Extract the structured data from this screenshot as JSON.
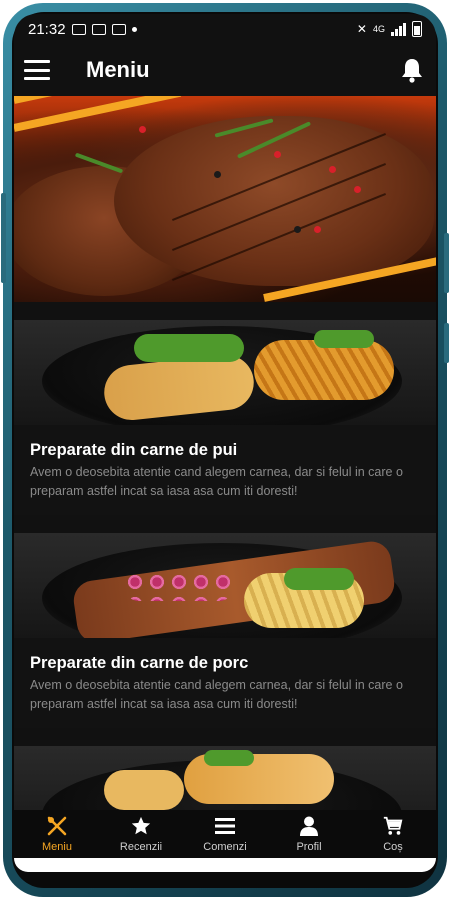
{
  "status_bar": {
    "time": "21:32"
  },
  "app_bar": {
    "title": "Meniu",
    "menu_icon": "hamburger-icon",
    "notification_icon": "bell-icon"
  },
  "hero": {
    "image": "grilled-steak-banner"
  },
  "categories": [
    {
      "title": "Preparate din carne de pui",
      "description": "Avem o deosebita atentie cand alegem carnea, dar si felul in care o preparam astfel incat sa iasa asa cum iti doresti!",
      "image": "chicken-strips-fries"
    },
    {
      "title": "Preparate din carne de porc",
      "description": "Avem o deosebita atentie cand alegem carnea, dar si felul in care o preparam astfel incat sa iasa asa cum iti doresti!",
      "image": "pork-ribs-fries"
    }
  ],
  "bottom_nav": {
    "items": [
      {
        "label": "Meniu",
        "icon": "fork-knife-icon",
        "active": true
      },
      {
        "label": "Recenzii",
        "icon": "star-icon",
        "active": false
      },
      {
        "label": "Comenzi",
        "icon": "list-icon",
        "active": false
      },
      {
        "label": "Profil",
        "icon": "person-icon",
        "active": false
      },
      {
        "label": "Coș",
        "icon": "cart-icon",
        "active": false
      }
    ]
  },
  "colors": {
    "accent": "#f5a623",
    "background": "#111111",
    "frame": "#1d5a6b"
  }
}
